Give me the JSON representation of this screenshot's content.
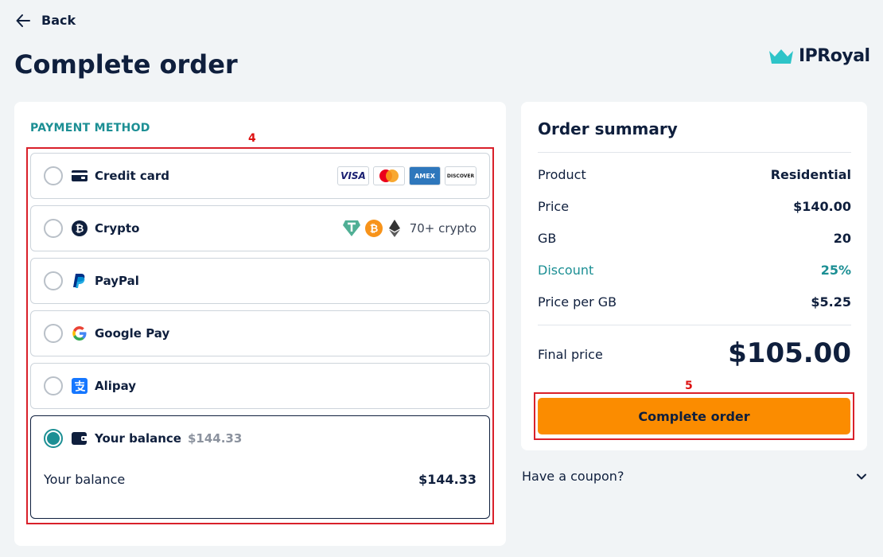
{
  "header": {
    "back_label": "Back",
    "title": "Complete order",
    "brand": "IPRoyal"
  },
  "payment": {
    "section_label": "PAYMENT METHOD",
    "annotation": "4",
    "options": [
      {
        "label": "Credit card",
        "logos": [
          "VISA",
          "",
          "AMEX",
          "DISCOVER"
        ]
      },
      {
        "label": "Crypto",
        "extra": "70+ crypto"
      },
      {
        "label": "PayPal"
      },
      {
        "label": "Google Pay"
      },
      {
        "label": "Alipay"
      },
      {
        "label": "Your balance",
        "amount": "$144.33",
        "selected": true
      }
    ],
    "balance_row": {
      "label": "Your balance",
      "value": "$144.33"
    }
  },
  "summary": {
    "title": "Order summary",
    "rows": [
      {
        "label": "Product",
        "value": "Residential"
      },
      {
        "label": "Price",
        "value": "$140.00"
      },
      {
        "label": "GB",
        "value": "20"
      },
      {
        "label": "Discount",
        "value": "25%"
      },
      {
        "label": "Price per GB",
        "value": "$5.25"
      }
    ],
    "final_label": "Final price",
    "final_value": "$105.00",
    "cta_label": "Complete order",
    "annotation": "5"
  },
  "coupon": {
    "label": "Have a coupon?"
  },
  "colors": {
    "accent": "#1c8f94",
    "cta": "#fb8c00",
    "text": "#0f1f3d",
    "annotation": "#d9202a"
  }
}
